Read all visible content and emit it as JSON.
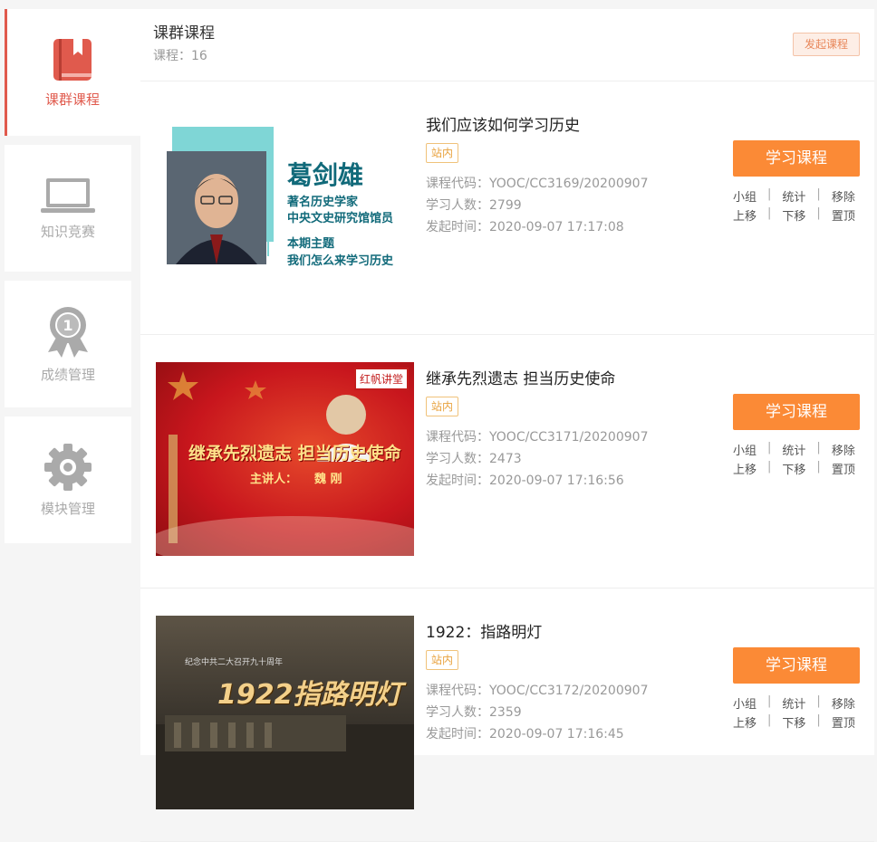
{
  "sidebar": {
    "items": [
      {
        "label": "课群课程",
        "icon": "book-icon",
        "active": true
      },
      {
        "label": "知识竞赛",
        "icon": "laptop-icon"
      },
      {
        "label": "成绩管理",
        "icon": "medal-icon"
      },
      {
        "label": "模块管理",
        "icon": "gear-icon"
      }
    ]
  },
  "header": {
    "title": "课群课程",
    "count_label": "课程：",
    "count_value": "16",
    "start_button": "发起课程"
  },
  "labels": {
    "tag": "站内",
    "code": "课程代码：",
    "learners": "学习人数：",
    "time": "发起时间：",
    "study_button": "学习课程",
    "ops_row1": [
      "小组",
      "统计",
      "移除"
    ],
    "ops_row2": [
      "上移",
      "下移",
      "置顶"
    ],
    "separator": "|"
  },
  "courses": [
    {
      "title": "我们应该如何学习历史",
      "code": "YOOC/CC3169/20200907",
      "learners": "2799",
      "time": "2020-09-07 17:17:08",
      "thumb_text": {
        "name": "葛剑雄",
        "line1": "著名历史学家",
        "line2": "中央文史研究馆馆员",
        "line3": "本期主题",
        "line4": "我们怎么来学习历史"
      }
    },
    {
      "title": "继承先烈遗志 担当历史使命",
      "code": "YOOC/CC3171/20200907",
      "learners": "2473",
      "time": "2020-09-07 17:16:56",
      "thumb_text": {
        "seal": "红帆讲堂",
        "headline": "继承先烈遗志 担当历史使命",
        "speaker_label": "主讲人：",
        "speaker": "魏 刚"
      }
    },
    {
      "title": "1922：指路明灯",
      "code": "YOOC/CC3172/20200907",
      "learners": "2359",
      "time": "2020-09-07 17:16:45",
      "thumb_text": {
        "small": "纪念中共二大召开九十周年",
        "headline": "1922指路明灯"
      }
    }
  ],
  "colors": {
    "accent": "#e05a4d",
    "button": "#fb8a36",
    "tag": "#e8a23d"
  }
}
